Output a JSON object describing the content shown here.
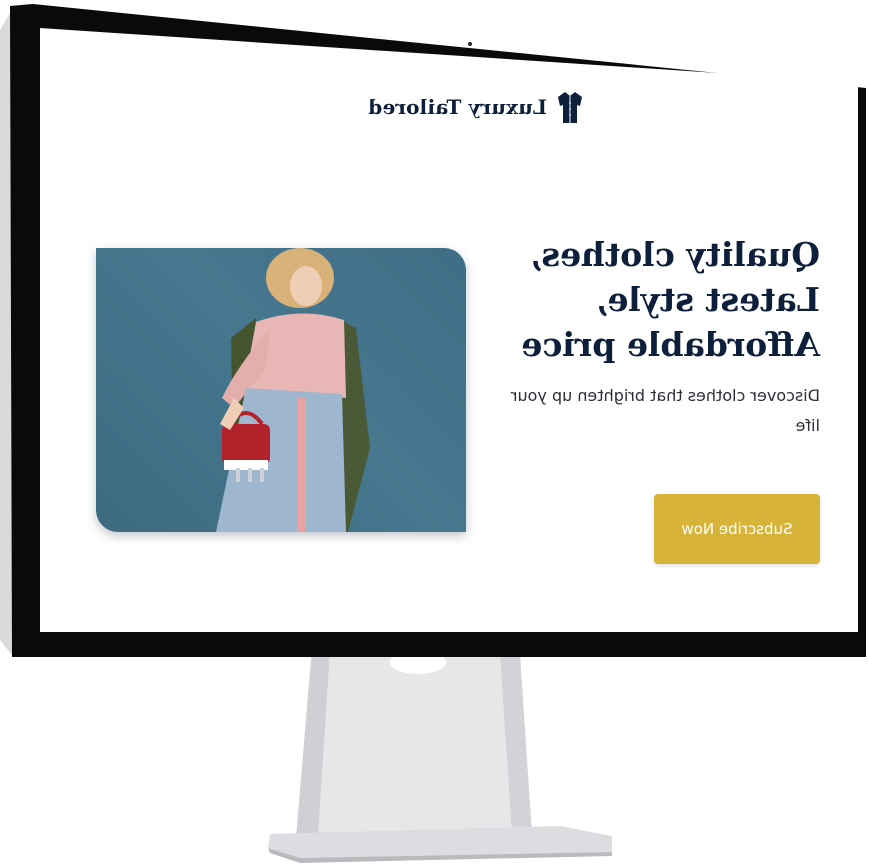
{
  "brand": {
    "name": "Luxury Tailored",
    "icon": "shirt-icon"
  },
  "hero": {
    "headline_lines": [
      "Quality clothes,",
      "Latest style,",
      "Affordable price"
    ],
    "subtext": "Discover clothes that brighten up your life",
    "cta_label": "Subscribe Now",
    "image": "fashion-model-photo"
  },
  "colors": {
    "navy": "#0d1f3a",
    "accent_gold": "#d7b33a",
    "photo_background": "#47788f",
    "monitor_bezel": "#0a0a0a",
    "stand_silver": "#e3e4e6"
  }
}
